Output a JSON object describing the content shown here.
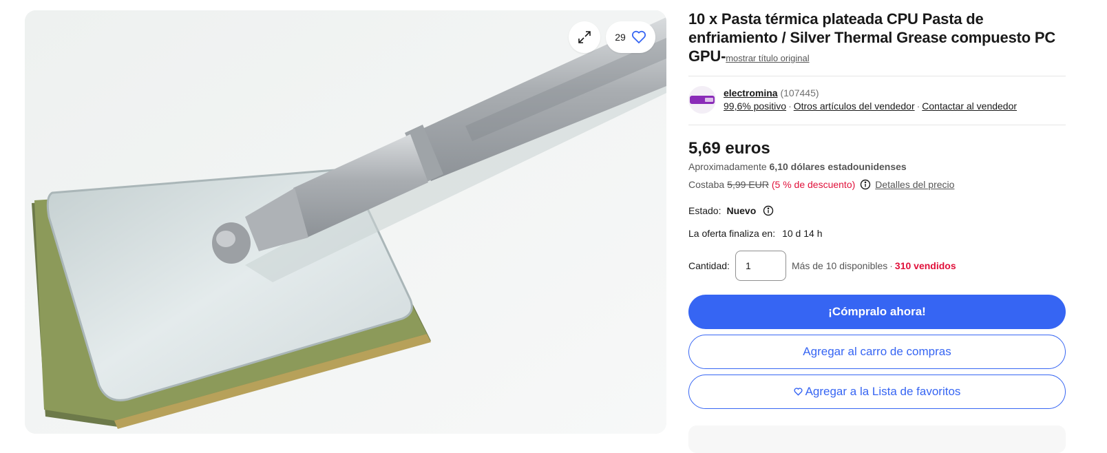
{
  "gallery": {
    "watch_count": "29",
    "icons": {
      "expand": "expand-icon",
      "watch": "heart-icon"
    }
  },
  "item": {
    "title": "10 x Pasta térmica plateada CPU Pasta de enfriamiento / Silver Thermal Grease compuesto PC GPU-",
    "show_original": "mostrar título original"
  },
  "seller": {
    "name": "electromina",
    "feedback_count": "(107445)",
    "positive": "99,6% positivo",
    "other_items": "Otros artículos del vendedor",
    "contact": "Contactar al vendedor"
  },
  "pricing": {
    "price": "5,69 euros",
    "approx_prefix": "Aproximadamente",
    "approx_value": "6,10 dólares estadounidenses",
    "was_label": "Costaba",
    "was_price": "5,99 EUR",
    "discount": "(5 % de descuento)",
    "details_link": "Detalles del precio"
  },
  "condition": {
    "label": "Estado:",
    "value": "Nuevo"
  },
  "ends": {
    "label": "La oferta finaliza en:",
    "value": "10 d 14 h"
  },
  "quantity": {
    "label": "Cantidad:",
    "value": "1",
    "available": "Más de 10 disponibles",
    "sold": "310 vendidos"
  },
  "buttons": {
    "buy_now": "¡Cómpralo ahora!",
    "add_to_cart": "Agregar al carro de compras",
    "add_to_watchlist": "Agregar a la Lista de favoritos"
  },
  "colors": {
    "accent": "#3665f3",
    "discount": "#e0103a"
  }
}
